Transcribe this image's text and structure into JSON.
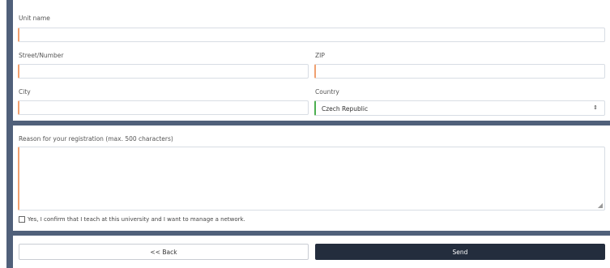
{
  "form": {
    "unit_name_label": "Unit name",
    "unit_name_value": "",
    "street_label": "Street/Number",
    "street_value": "",
    "zip_label": "ZIP",
    "zip_value": "",
    "city_label": "City",
    "city_value": "",
    "country_label": "Country",
    "country_value": "Czech Republic",
    "reason_label": "Reason for your registration (max. 500 characters)",
    "reason_value": "",
    "confirm_label": "Yes, I confirm that I teach at this university and I want to manage a network.",
    "confirm_checked": false
  },
  "actions": {
    "back_label": "<< Back",
    "send_label": "Send"
  },
  "colors": {
    "accent_invalid": "#f0a070",
    "accent_valid": "#4caf50",
    "primary_button": "#232d3d",
    "frame": "#50607a"
  },
  "icons": {
    "select_arrow": "chevron-updown-icon",
    "resize_grip": "resize-grip-icon"
  }
}
